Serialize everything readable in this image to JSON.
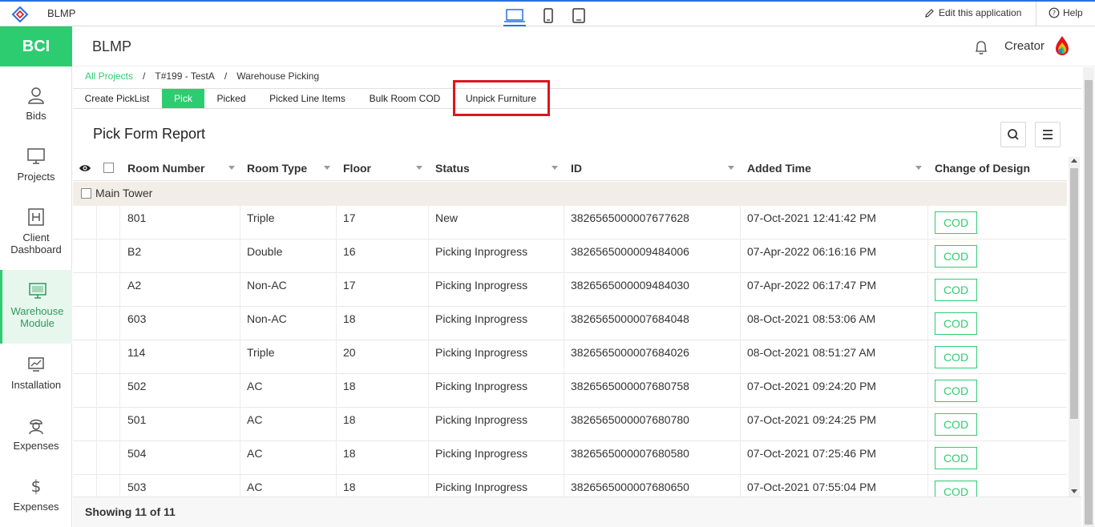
{
  "topbar": {
    "app_name": "BLMP",
    "edit_label": "Edit this application",
    "help_label": "Help"
  },
  "sidebar": {
    "brand": "BCI",
    "items": [
      {
        "label": "Bids",
        "icon": "user-icon"
      },
      {
        "label": "Projects",
        "icon": "monitor-icon"
      },
      {
        "label": "Client Dashboard",
        "icon": "h-box-icon"
      },
      {
        "label": "Warehouse Module",
        "icon": "monitor-icon",
        "active": true
      },
      {
        "label": "Installation",
        "icon": "chart-screen-icon"
      },
      {
        "label": "Expenses",
        "icon": "worker-icon"
      },
      {
        "label": "Expenses",
        "icon": "dollar-icon"
      }
    ]
  },
  "header": {
    "title": "BLMP",
    "user": "Creator"
  },
  "breadcrumb": {
    "items": [
      "All Projects",
      "/",
      "T#199 - TestA",
      "/",
      "Warehouse Picking"
    ]
  },
  "tabs": [
    {
      "label": "Create PickList"
    },
    {
      "label": "Pick",
      "active": true
    },
    {
      "label": "Picked"
    },
    {
      "label": "Picked Line Items"
    },
    {
      "label": "Bulk Room COD"
    },
    {
      "label": "Unpick Furniture"
    }
  ],
  "report": {
    "title": "Pick Form Report",
    "columns": [
      "Room Number",
      "Room Type",
      "Floor",
      "Status",
      "ID",
      "Added Time",
      "Change of Design"
    ],
    "group": "Main Tower",
    "rows": [
      {
        "room": "801",
        "type": "Triple",
        "floor": "17",
        "status": "New",
        "id": "3826565000007677628",
        "added": "07-Oct-2021 12:41:42 PM",
        "cod": "COD"
      },
      {
        "room": "B2",
        "type": "Double",
        "floor": "16",
        "status": "Picking Inprogress",
        "id": "3826565000009484006",
        "added": "07-Apr-2022 06:16:16 PM",
        "cod": "COD"
      },
      {
        "room": "A2",
        "type": "Non-AC",
        "floor": "17",
        "status": "Picking Inprogress",
        "id": "3826565000009484030",
        "added": "07-Apr-2022 06:17:47 PM",
        "cod": "COD"
      },
      {
        "room": "603",
        "type": "Non-AC",
        "floor": "18",
        "status": "Picking Inprogress",
        "id": "3826565000007684048",
        "added": "08-Oct-2021 08:53:06 AM",
        "cod": "COD"
      },
      {
        "room": "114",
        "type": "Triple",
        "floor": "20",
        "status": "Picking Inprogress",
        "id": "3826565000007684026",
        "added": "08-Oct-2021 08:51:27 AM",
        "cod": "COD"
      },
      {
        "room": "502",
        "type": "AC",
        "floor": "18",
        "status": "Picking Inprogress",
        "id": "3826565000007680758",
        "added": "07-Oct-2021 09:24:20 PM",
        "cod": "COD"
      },
      {
        "room": "501",
        "type": "AC",
        "floor": "18",
        "status": "Picking Inprogress",
        "id": "3826565000007680780",
        "added": "07-Oct-2021 09:24:25 PM",
        "cod": "COD"
      },
      {
        "room": "504",
        "type": "AC",
        "floor": "18",
        "status": "Picking Inprogress",
        "id": "3826565000007680580",
        "added": "07-Oct-2021 07:25:46 PM",
        "cod": "COD"
      },
      {
        "room": "503",
        "type": "AC",
        "floor": "18",
        "status": "Picking Inprogress",
        "id": "3826565000007680650",
        "added": "07-Oct-2021 07:55:04 PM",
        "cod": "COD"
      }
    ],
    "footer": "Showing 11 of 11"
  },
  "colors": {
    "accent": "#2ecc71",
    "highlight": "#e0141e",
    "topline": "#2a6fdb"
  }
}
